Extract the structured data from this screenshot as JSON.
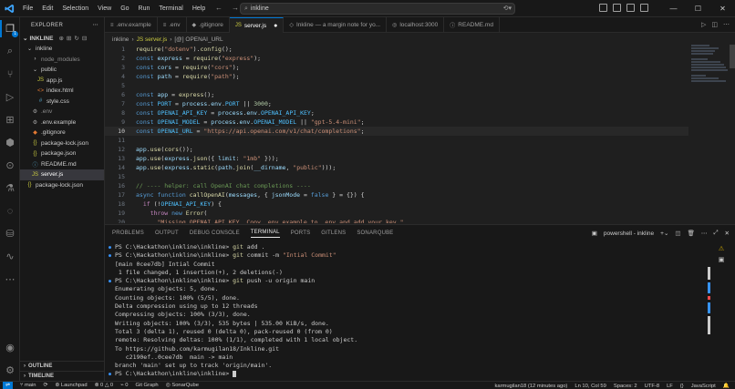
{
  "titlebar": {
    "menu": [
      "File",
      "Edit",
      "Selection",
      "View",
      "Go",
      "Run",
      "Terminal",
      "Help"
    ],
    "search": "inkline",
    "window_controls": [
      "—",
      "☐",
      "✕"
    ]
  },
  "sidebar": {
    "header": "EXPLORER",
    "root": "INKLINE",
    "items": [
      {
        "label": "inkline",
        "icon": "chevron-down",
        "indent": 1,
        "color": "#cccccc",
        "kind": "folder"
      },
      {
        "label": "node_modules",
        "icon": "chevron-right",
        "indent": 2,
        "color": "#8c8c8c",
        "kind": "folder"
      },
      {
        "label": "public",
        "icon": "chevron-down",
        "indent": 2,
        "color": "#cccccc",
        "kind": "folder"
      },
      {
        "label": "app.js",
        "icon": "js",
        "indent": 3,
        "color": "#cccccc",
        "kind": "file"
      },
      {
        "label": "index.html",
        "icon": "html",
        "indent": 3,
        "color": "#cccccc",
        "kind": "file"
      },
      {
        "label": "style.css",
        "icon": "css",
        "indent": 3,
        "color": "#cccccc",
        "kind": "file"
      },
      {
        "label": ".env",
        "icon": "env",
        "indent": 2,
        "color": "#8c8c8c",
        "kind": "file"
      },
      {
        "label": ".env.example",
        "icon": "env",
        "indent": 2,
        "color": "#cccccc",
        "kind": "file"
      },
      {
        "label": ".gitignore",
        "icon": "git",
        "indent": 2,
        "color": "#cccccc",
        "kind": "file"
      },
      {
        "label": "package-lock.json",
        "icon": "json",
        "indent": 2,
        "color": "#cccccc",
        "kind": "file"
      },
      {
        "label": "package.json",
        "icon": "json",
        "indent": 2,
        "color": "#cccccc",
        "kind": "file"
      },
      {
        "label": "README.md",
        "icon": "md",
        "indent": 2,
        "color": "#cccccc",
        "kind": "file"
      },
      {
        "label": "server.js",
        "icon": "js",
        "indent": 2,
        "color": "#ffffff",
        "kind": "file",
        "selected": true
      },
      {
        "label": "package-lock.json",
        "icon": "json",
        "indent": 1,
        "color": "#cccccc",
        "kind": "file"
      }
    ],
    "outline": "OUTLINE",
    "timeline": "TIMELINE"
  },
  "tabs": [
    {
      "label": ".env.example",
      "icon": "≡",
      "active": false
    },
    {
      "label": ".env",
      "icon": "≡",
      "active": false
    },
    {
      "label": ".gitignore",
      "icon": "◆",
      "active": false
    },
    {
      "label": "server.js",
      "icon": "JS",
      "active": true
    },
    {
      "label": "Inkline — a margin note for yo...",
      "icon": "◇",
      "active": false
    },
    {
      "label": "localhost:3000",
      "icon": "◎",
      "active": false
    },
    {
      "label": "README.md",
      "icon": "ⓘ",
      "active": false
    }
  ],
  "breadcrumb": [
    "inkline",
    "JS server.js",
    "[@] OPENAI_URL"
  ],
  "editor": {
    "current_line": 10,
    "lines": [
      {
        "n": "1",
        "tokens": [
          [
            "fn",
            "require"
          ],
          [
            "pl",
            "("
          ],
          [
            "str",
            "\"dotenv\""
          ],
          [
            "pl",
            ")."
          ],
          [
            "fn",
            "config"
          ],
          [
            "pl",
            "();"
          ]
        ]
      },
      {
        "n": "2",
        "tokens": [
          [
            "kw",
            "const "
          ],
          [
            "var",
            "express"
          ],
          [
            "pl",
            " = "
          ],
          [
            "fn",
            "require"
          ],
          [
            "pl",
            "("
          ],
          [
            "str",
            "\"express\""
          ],
          [
            "pl",
            ");"
          ]
        ]
      },
      {
        "n": "3",
        "tokens": [
          [
            "kw",
            "const "
          ],
          [
            "var",
            "cors"
          ],
          [
            "pl",
            " = "
          ],
          [
            "fn",
            "require"
          ],
          [
            "pl",
            "("
          ],
          [
            "str",
            "\"cors\""
          ],
          [
            "pl",
            ");"
          ]
        ]
      },
      {
        "n": "4",
        "tokens": [
          [
            "kw",
            "const "
          ],
          [
            "var",
            "path"
          ],
          [
            "pl",
            " = "
          ],
          [
            "fn",
            "require"
          ],
          [
            "pl",
            "("
          ],
          [
            "str",
            "\"path\""
          ],
          [
            "pl",
            ");"
          ]
        ]
      },
      {
        "n": "5",
        "tokens": []
      },
      {
        "n": "6",
        "tokens": [
          [
            "kw",
            "const "
          ],
          [
            "var",
            "app"
          ],
          [
            "pl",
            " = "
          ],
          [
            "fn",
            "express"
          ],
          [
            "pl",
            "();"
          ]
        ]
      },
      {
        "n": "7",
        "tokens": [
          [
            "kw",
            "const "
          ],
          [
            "cst",
            "PORT"
          ],
          [
            "pl",
            " = "
          ],
          [
            "var",
            "process"
          ],
          [
            "pl",
            "."
          ],
          [
            "var",
            "env"
          ],
          [
            "pl",
            "."
          ],
          [
            "cst",
            "PORT"
          ],
          [
            "pl",
            " || "
          ],
          [
            "num",
            "3000"
          ],
          [
            "pl",
            ";"
          ]
        ]
      },
      {
        "n": "8",
        "tokens": [
          [
            "kw",
            "const "
          ],
          [
            "cst",
            "OPENAI_API_KEY"
          ],
          [
            "pl",
            " = "
          ],
          [
            "var",
            "process"
          ],
          [
            "pl",
            "."
          ],
          [
            "var",
            "env"
          ],
          [
            "pl",
            "."
          ],
          [
            "cst",
            "OPENAI_API_KEY"
          ],
          [
            "pl",
            ";"
          ]
        ]
      },
      {
        "n": "9",
        "tokens": [
          [
            "kw",
            "const "
          ],
          [
            "cst",
            "OPENAI_MODEL"
          ],
          [
            "pl",
            " = "
          ],
          [
            "var",
            "process"
          ],
          [
            "pl",
            "."
          ],
          [
            "var",
            "env"
          ],
          [
            "pl",
            "."
          ],
          [
            "cst",
            "OPENAI_MODEL"
          ],
          [
            "pl",
            " || "
          ],
          [
            "str",
            "\"gpt-5.4-mini\""
          ],
          [
            "pl",
            ";"
          ]
        ]
      },
      {
        "n": "10",
        "tokens": [
          [
            "kw",
            "const "
          ],
          [
            "cst",
            "OPENAI_URL"
          ],
          [
            "pl",
            " = "
          ],
          [
            "str",
            "\"https://api.openai.com/v1/chat/completions\""
          ],
          [
            "pl",
            ";"
          ]
        ]
      },
      {
        "n": "11",
        "tokens": []
      },
      {
        "n": "12",
        "tokens": [
          [
            "var",
            "app"
          ],
          [
            "pl",
            "."
          ],
          [
            "fn",
            "use"
          ],
          [
            "pl",
            "("
          ],
          [
            "fn",
            "cors"
          ],
          [
            "pl",
            "());"
          ]
        ]
      },
      {
        "n": "13",
        "tokens": [
          [
            "var",
            "app"
          ],
          [
            "pl",
            "."
          ],
          [
            "fn",
            "use"
          ],
          [
            "pl",
            "("
          ],
          [
            "var",
            "express"
          ],
          [
            "pl",
            "."
          ],
          [
            "fn",
            "json"
          ],
          [
            "pl",
            "({ "
          ],
          [
            "var",
            "limit"
          ],
          [
            "pl",
            ": "
          ],
          [
            "str",
            "\"1mb\""
          ],
          [
            "pl",
            " }));"
          ]
        ]
      },
      {
        "n": "14",
        "tokens": [
          [
            "var",
            "app"
          ],
          [
            "pl",
            "."
          ],
          [
            "fn",
            "use"
          ],
          [
            "pl",
            "("
          ],
          [
            "var",
            "express"
          ],
          [
            "pl",
            "."
          ],
          [
            "fn",
            "static"
          ],
          [
            "pl",
            "("
          ],
          [
            "var",
            "path"
          ],
          [
            "pl",
            "."
          ],
          [
            "fn",
            "join"
          ],
          [
            "pl",
            "("
          ],
          [
            "var",
            "__dirname"
          ],
          [
            "pl",
            ", "
          ],
          [
            "str",
            "\"public\""
          ],
          [
            "pl",
            ")));"
          ]
        ]
      },
      {
        "n": "15",
        "tokens": []
      },
      {
        "n": "16",
        "tokens": [
          [
            "cmt",
            "// ---- helper: call OpenAI chat completions ----"
          ]
        ]
      },
      {
        "n": "17",
        "tokens": [
          [
            "kw",
            "async function "
          ],
          [
            "fn",
            "callOpenAI"
          ],
          [
            "pl",
            "("
          ],
          [
            "var",
            "messages"
          ],
          [
            "pl",
            ", { "
          ],
          [
            "var",
            "jsonMode"
          ],
          [
            "pl",
            " = "
          ],
          [
            "kw",
            "false"
          ],
          [
            "pl",
            " } = {}) {"
          ]
        ]
      },
      {
        "n": "18",
        "tokens": [
          [
            "pl",
            "  "
          ],
          [
            "ctl",
            "if"
          ],
          [
            "pl",
            " (!"
          ],
          [
            "cst",
            "OPENAI_API_KEY"
          ],
          [
            "pl",
            ") {"
          ]
        ]
      },
      {
        "n": "19",
        "tokens": [
          [
            "pl",
            "    "
          ],
          [
            "ctl",
            "throw "
          ],
          [
            "kw",
            "new "
          ],
          [
            "fn",
            "Error"
          ],
          [
            "pl",
            "("
          ]
        ]
      },
      {
        "n": "20",
        "tokens": [
          [
            "pl",
            "      "
          ],
          [
            "str",
            "\"Missing OPENAI_API_KEY. Copy .env.example to .env and add your key.\""
          ]
        ]
      }
    ]
  },
  "panel": {
    "tabs": [
      "PROBLEMS",
      "OUTPUT",
      "DEBUG CONSOLE",
      "TERMINAL",
      "PORTS",
      "GITLENS",
      "SONARQUBE"
    ],
    "active_tab": "TERMINAL",
    "shell_label": "powershell - inkline",
    "terminal_lines": [
      {
        "mark": true,
        "prompt": "PS C:\\Hackathon\\inkline\\inkline> ",
        "cmd": "git",
        "rest": " add ."
      },
      {
        "mark": true,
        "prompt": "PS C:\\Hackathon\\inkline\\inkline> ",
        "cmd": "git",
        "rest": " commit -m ",
        "arg": "\"Intial Commit\""
      },
      {
        "mark": false,
        "text": "[main 0cee7db] Intial Commit"
      },
      {
        "mark": false,
        "text": " 1 file changed, 1 insertion(+), 2 deletions(-)"
      },
      {
        "mark": true,
        "prompt": "PS C:\\Hackathon\\inkline\\inkline> ",
        "cmd": "git",
        "rest": " push -u origin main"
      },
      {
        "mark": false,
        "text": "Enumerating objects: 5, done."
      },
      {
        "mark": false,
        "text": "Counting objects: 100% (5/5), done."
      },
      {
        "mark": false,
        "text": "Delta compression using up to 12 threads"
      },
      {
        "mark": false,
        "text": "Compressing objects: 100% (3/3), done."
      },
      {
        "mark": false,
        "text": "Writing objects: 100% (3/3), 535 bytes | 535.00 KiB/s, done."
      },
      {
        "mark": false,
        "text": "Total 3 (delta 1), reused 0 (delta 0), pack-reused 0 (from 0)"
      },
      {
        "mark": false,
        "text": "remote: Resolving deltas: 100% (1/1), completed with 1 local object."
      },
      {
        "mark": false,
        "text": "To https://github.com/karmugilan18/Inkline.git"
      },
      {
        "mark": false,
        "text": "   c2190ef..0cee7db  main -> main"
      },
      {
        "mark": false,
        "text": "branch 'main' set up to track 'origin/main'."
      },
      {
        "mark": true,
        "prompt": "PS C:\\Hackathon\\inkline\\inkline> ",
        "cursor": true
      }
    ]
  },
  "statusbar": {
    "branch": "main",
    "sync": "⟳",
    "launchpad": "Launchpad",
    "problems": "⊗ 0 △ 0",
    "ports": "0",
    "gitgraph": "Git Graph",
    "sonar": "SonarQube",
    "blame": "karmugilan18 (12 minutes ago)",
    "position": "Ln 10, Col 59",
    "spaces": "Spaces: 2",
    "encoding": "UTF-8",
    "eol": "LF",
    "braces": "{}",
    "language": "JavaScript"
  },
  "colors": {
    "accent": "#0078d4",
    "background": "#1f1f1f",
    "sidebar": "#181818"
  }
}
